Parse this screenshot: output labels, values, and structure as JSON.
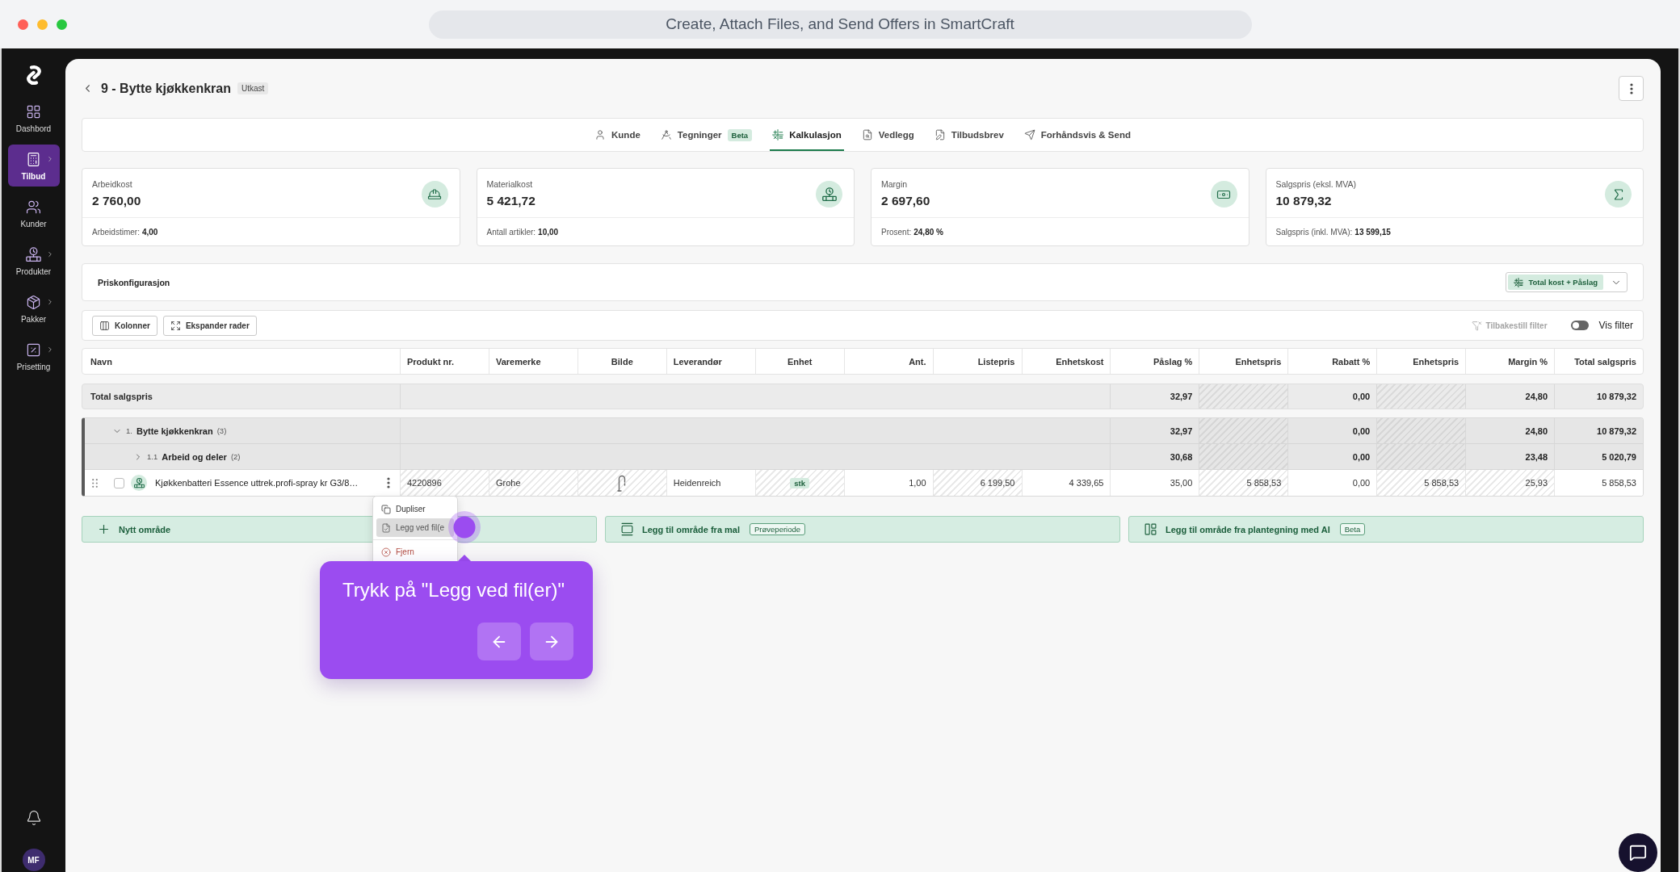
{
  "window": {
    "title": "Create, Attach Files, and Send Offers in SmartCraft"
  },
  "sidebar": {
    "items": [
      {
        "label": "Dashbord",
        "selected": false,
        "submenu": false
      },
      {
        "label": "Tilbud",
        "selected": true,
        "submenu": true
      },
      {
        "label": "Kunder",
        "selected": false,
        "submenu": false
      },
      {
        "label": "Produkter",
        "selected": false,
        "submenu": true
      },
      {
        "label": "Pakker",
        "selected": false,
        "submenu": true
      },
      {
        "label": "Prisetting",
        "selected": false,
        "submenu": true
      }
    ],
    "avatar": "MF"
  },
  "header": {
    "title": "9 - Bytte kjøkkenkran",
    "status": "Utkast"
  },
  "tabs": [
    {
      "label": "Kunde",
      "selected": false
    },
    {
      "label": "Tegninger",
      "badge": "Beta",
      "selected": false
    },
    {
      "label": "Kalkulasjon",
      "selected": true
    },
    {
      "label": "Vedlegg",
      "selected": false
    },
    {
      "label": "Tilbudsbrev",
      "selected": false
    },
    {
      "label": "Forhåndsvis & Send",
      "selected": false
    }
  ],
  "summary_cards": [
    {
      "label": "Arbeidkost",
      "value": "2 760,00",
      "footer_label": "Arbeidstimer:",
      "footer_value": "4,00"
    },
    {
      "label": "Materialkost",
      "value": "5 421,72",
      "footer_label": "Antall artikler:",
      "footer_value": "10,00"
    },
    {
      "label": "Margin",
      "value": "2 697,60",
      "footer_label": "Prosent:",
      "footer_value": "24,80 %"
    },
    {
      "label": "Salgspris (eksl. MVA)",
      "value": "10 879,32",
      "footer_label": "Salgspris (inkl. MVA):",
      "footer_value": "13 599,15"
    }
  ],
  "price_config": {
    "title": "Priskonfigurasjon",
    "mode": "Total kost + Påslag"
  },
  "toolbar": {
    "buttons": [
      "Kolonner",
      "Ekspander rader"
    ],
    "reset_filter": {
      "label": "Tilbakestill filter",
      "disabled": true
    },
    "filter_toggle": {
      "label": "Vis filter",
      "on": false
    }
  },
  "table": {
    "columns": [
      {
        "label": "Navn",
        "kind": "text",
        "locked": false
      },
      {
        "label": "Produkt nr.",
        "kind": "text",
        "locked": true
      },
      {
        "label": "Varemerke",
        "kind": "text",
        "locked": true
      },
      {
        "label": "Bilde",
        "kind": "image",
        "locked": true
      },
      {
        "label": "Leverandør",
        "kind": "text",
        "locked": false
      },
      {
        "label": "Enhet",
        "kind": "unit",
        "locked": true
      },
      {
        "label": "Ant.",
        "kind": "number",
        "locked": false
      },
      {
        "label": "Listepris",
        "kind": "number",
        "locked": true
      },
      {
        "label": "Enhetskost",
        "kind": "number",
        "locked": false
      },
      {
        "label": "Påslag %",
        "kind": "number",
        "locked": false
      },
      {
        "label": "Enhetspris",
        "kind": "number",
        "locked": true
      },
      {
        "label": "Rabatt %",
        "kind": "number",
        "locked": false
      },
      {
        "label": "Enhetspris",
        "kind": "number",
        "locked": true
      },
      {
        "label": "Margin %",
        "kind": "number",
        "locked": true
      },
      {
        "label": "Total salgspris",
        "kind": "number",
        "locked": false
      }
    ],
    "total_row": {
      "label": "Total salgspris",
      "values": [
        {
          "kind": "value",
          "text": "32,97"
        },
        {
          "kind": "blank"
        },
        {
          "kind": "value",
          "text": "0,00"
        },
        {
          "kind": "blank"
        },
        {
          "kind": "value",
          "text": "24,80"
        },
        {
          "kind": "value",
          "text": "10 879,32"
        }
      ]
    },
    "groups": [
      {
        "kind": "group",
        "number": "1.",
        "name": "Bytte kjøkkenkran",
        "count": "(3)",
        "expanded": true,
        "values": [
          {
            "kind": "value",
            "text": "32,97"
          },
          {
            "kind": "blank"
          },
          {
            "kind": "value",
            "text": "0,00"
          },
          {
            "kind": "blank"
          },
          {
            "kind": "value",
            "text": "24,80"
          },
          {
            "kind": "value",
            "text": "10 879,32"
          }
        ],
        "children": [
          {
            "kind": "group",
            "number": "1.1",
            "name": "Arbeid og deler",
            "count": "(2)",
            "expanded": false,
            "values": [
              {
                "kind": "value",
                "text": "30,68"
              },
              {
                "kind": "blank"
              },
              {
                "kind": "value",
                "text": "0,00"
              },
              {
                "kind": "blank"
              },
              {
                "kind": "value",
                "text": "23,48"
              },
              {
                "kind": "value",
                "text": "5 020,79"
              }
            ]
          },
          {
            "kind": "item",
            "name": "Kjøkkenbatteri Essence uttrek.profi-spray kr G3/8…",
            "checked": false,
            "image": true,
            "cells": [
              "4220896",
              "Grohe",
              "Heidenreich",
              "stk",
              "1,00",
              "6 199,50",
              "4 339,65",
              "35,00",
              "5 858,53",
              "0,00",
              "5 858,53",
              "25,93",
              "5 858,53"
            ]
          }
        ]
      }
    ]
  },
  "context_menu": {
    "items": [
      {
        "label": "Dupliser",
        "kind": "action",
        "selected": false
      },
      {
        "label": "Legg ved fil(e",
        "kind": "action",
        "selected": true
      },
      {
        "label": "Fjern",
        "kind": "danger",
        "selected": false
      }
    ]
  },
  "add_buttons": [
    {
      "label": "Nytt område"
    },
    {
      "label": "Legg til område fra mal",
      "badge": "Prøveperiode"
    },
    {
      "label": "Legg til område fra plantegning med AI",
      "badge": "Beta"
    }
  ],
  "tour_tooltip": {
    "text": "Trykk på \"Legg ved fil(er)\""
  }
}
